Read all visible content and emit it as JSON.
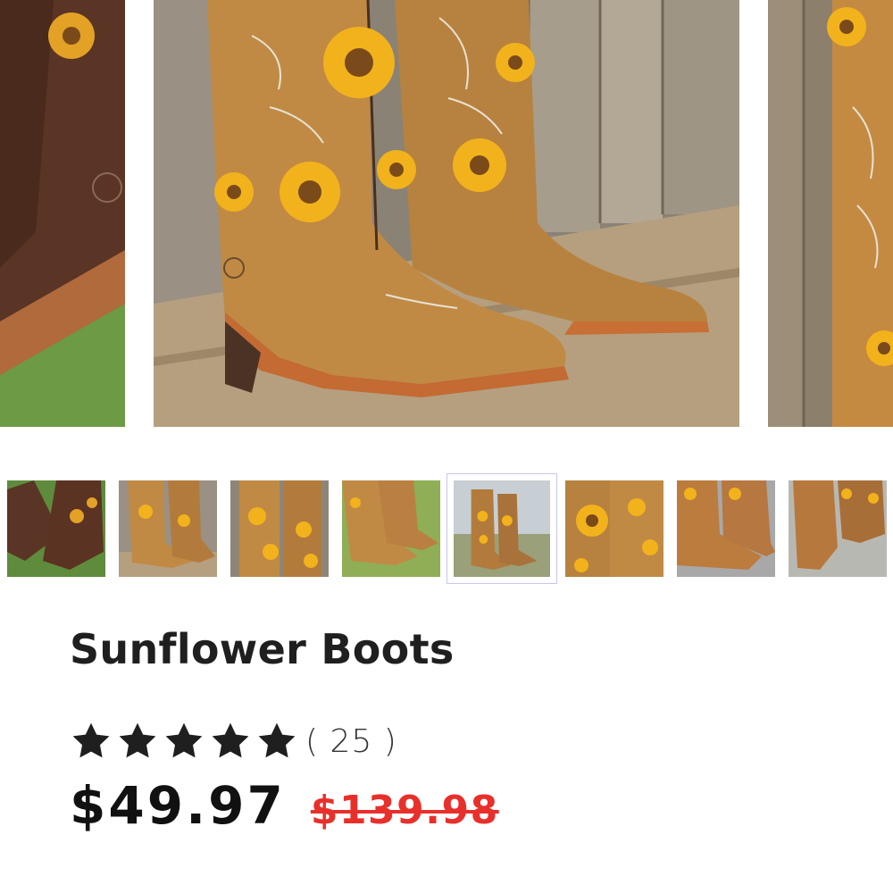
{
  "gallery": {
    "thumbnail_count": 8,
    "active_thumbnail_index": 5
  },
  "product": {
    "title": "Sunflower Boots",
    "rating": 5,
    "review_count": "( 25 )",
    "price": "$49.97",
    "compare_at_price": "$139.98"
  },
  "colors": {
    "star": "#1f1f1f",
    "sale_price": "#e8302b",
    "active_thumb_border": "#c9c5ee"
  }
}
